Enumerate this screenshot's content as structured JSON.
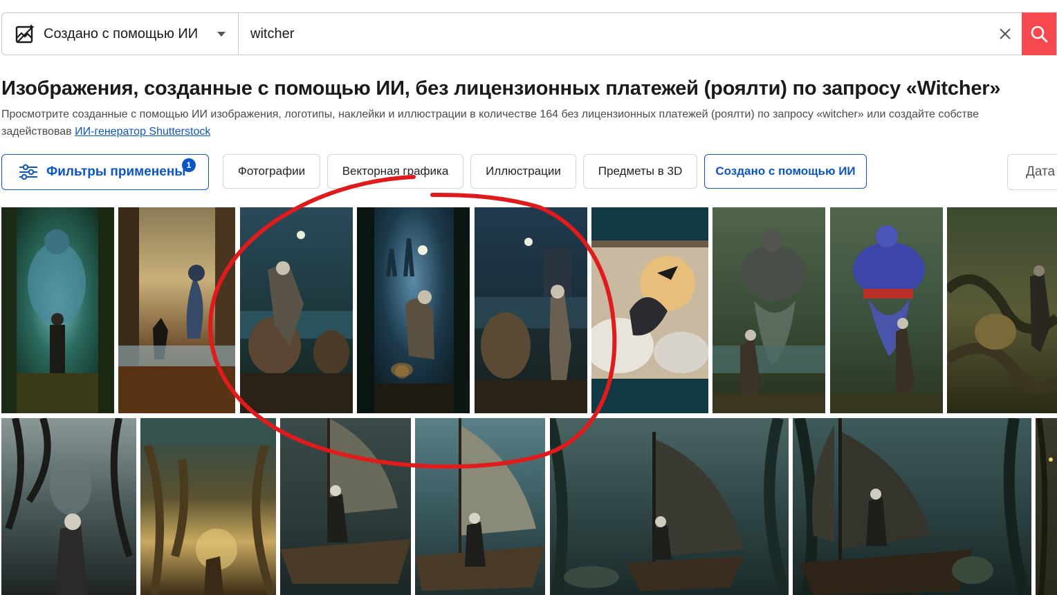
{
  "search": {
    "type_label": "Создано с помощью ИИ",
    "query": "witcher"
  },
  "heading": {
    "title": "Изображения, созданные с помощью ИИ, без лицензионных платежей (роялти) по запросу «Witcher»",
    "desc_line1": "Просмотрите созданные с помощью ИИ изображения, логотипы, наклейки и иллюстрации в количестве 164 без лицензионных платежей (роялти) по запросу «witcher» или создайте собстве",
    "desc_line2_prefix": "задействовав ",
    "desc_link": "ИИ-генератор Shutterstock"
  },
  "filters": {
    "applied_label": "Фильтры применены",
    "applied_count": "1",
    "chips": [
      "Фотографии",
      "Векторная графика",
      "Иллюстрации",
      "Предметы в 3D",
      "Создано с помощью ИИ"
    ],
    "active_chip": "Создано с помощью ИИ",
    "date_label": "Дата"
  },
  "images": {
    "row1": [
      "Giant genie over witcher in forest",
      "Witcher fighting demon by river",
      "Witcher with giant toads at night",
      "Witcher with toad under moonlit arch",
      "Witcher confronting toad at lake",
      "Abstract stormy battle scene",
      "Witcher facing grey genie in swamp",
      "Witcher facing blue genie",
      "Witcher in tangled forest"
    ],
    "row2": [
      "Witcher in dark twisted forest",
      "Witcher among golden trees",
      "Witcher on sailing boat",
      "Witcher on ship deck",
      "Witcher on boat in misty lake",
      "Witcher on boat with creature",
      "Partial image"
    ]
  },
  "colors": {
    "accent": "#0b55c4",
    "search_button": "#f5494f",
    "annotation": "#e01b1b"
  }
}
